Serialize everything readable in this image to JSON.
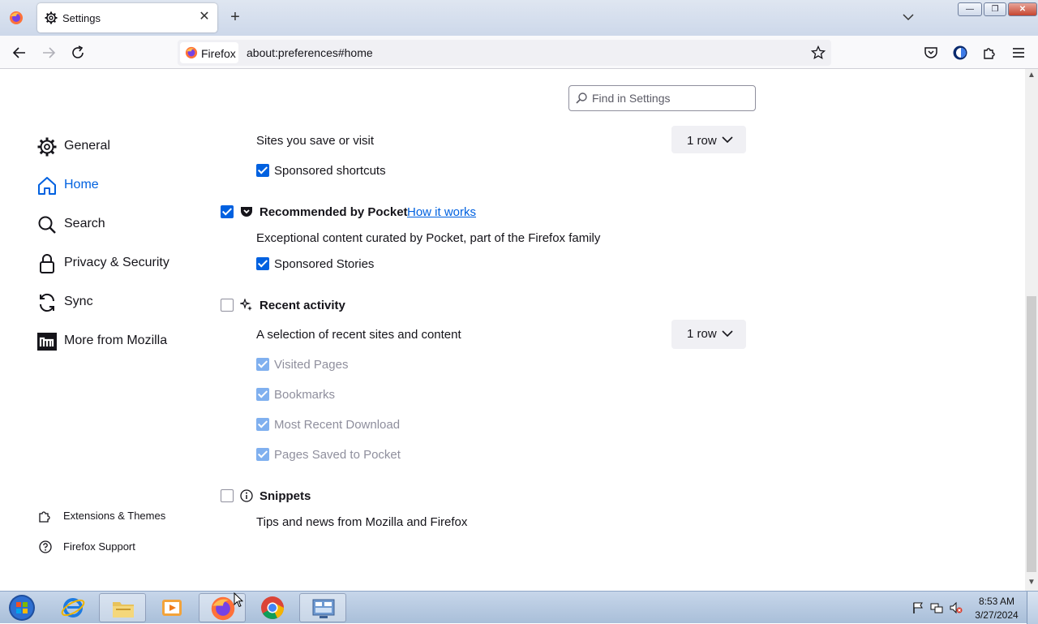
{
  "window": {
    "tab_title": "Settings",
    "tab_close_glyph": "✕",
    "new_tab_glyph": "+",
    "controls": {
      "minimize": "—",
      "maximize": "❐",
      "close": "✕"
    }
  },
  "navbar": {
    "identity_label": "Firefox",
    "url": "about:preferences#home"
  },
  "search": {
    "placeholder": "Find in Settings"
  },
  "sidebar": {
    "categories": [
      {
        "label": "General",
        "icon": "gear-icon"
      },
      {
        "label": "Home",
        "icon": "home-icon",
        "selected": true
      },
      {
        "label": "Search",
        "icon": "search-icon"
      },
      {
        "label": "Privacy & Security",
        "icon": "lock-icon"
      },
      {
        "label": "Sync",
        "icon": "sync-icon"
      },
      {
        "label": "More from Mozilla",
        "icon": "mozilla-icon"
      }
    ],
    "footer": [
      {
        "label": "Extensions & Themes",
        "icon": "puzzle-icon"
      },
      {
        "label": "Firefox Support",
        "icon": "help-icon"
      }
    ]
  },
  "content": {
    "shortcuts": {
      "sites_label": "Sites you save or visit",
      "rows_value": "1 row",
      "sponsored_label": "Sponsored shortcuts",
      "sponsored_checked": true
    },
    "pocket": {
      "checked": true,
      "title": "Recommended by Pocket",
      "link": "How it works",
      "description": "Exceptional content curated by Pocket, part of the Firefox family",
      "sponsored_label": "Sponsored Stories",
      "sponsored_checked": true
    },
    "recent": {
      "checked": false,
      "title": "Recent activity",
      "description": "A selection of recent sites and content",
      "rows_value": "1 row",
      "options": [
        {
          "label": "Visited Pages",
          "checked": true,
          "disabled": true
        },
        {
          "label": "Bookmarks",
          "checked": true,
          "disabled": true
        },
        {
          "label": "Most Recent Download",
          "checked": true,
          "disabled": true
        },
        {
          "label": "Pages Saved to Pocket",
          "checked": true,
          "disabled": true
        }
      ]
    },
    "snippets": {
      "checked": false,
      "title": "Snippets",
      "description": "Tips and news from Mozilla and Firefox"
    }
  },
  "taskbar": {
    "apps": [
      "start-orb",
      "internet-explorer",
      "file-explorer",
      "media-player",
      "firefox",
      "chrome",
      "control-panel"
    ],
    "active_app": "firefox",
    "time": "8:53 AM",
    "date": "3/27/2024"
  },
  "colors": {
    "accent": "#0061e0",
    "text": "#15141a",
    "disabled_checkbox": "#80b0ef"
  }
}
